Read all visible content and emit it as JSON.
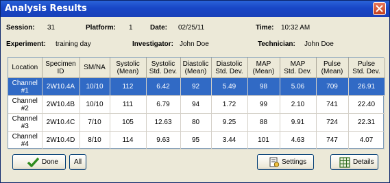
{
  "window": {
    "title": "Analysis Results"
  },
  "info": {
    "session_label": "Session:",
    "session_value": "31",
    "platform_label": "Platform:",
    "platform_value": "1",
    "date_label": "Date:",
    "date_value": "02/25/11",
    "time_label": "Time:",
    "time_value": "10:32 AM",
    "experiment_label": "Experiment:",
    "experiment_value": "training day",
    "investigator_label": "Investigator:",
    "investigator_value": "John Doe",
    "technician_label": "Technician:",
    "technician_value": "John Doe"
  },
  "table": {
    "headers": [
      [
        "Location"
      ],
      [
        "Specimen",
        "ID"
      ],
      [
        "SM/NA"
      ],
      [
        "Systolic",
        "(Mean)"
      ],
      [
        "Systolic",
        "Std. Dev."
      ],
      [
        "Diastolic",
        "(Mean)"
      ],
      [
        "Diastolic",
        "Std. Dev."
      ],
      [
        "MAP",
        "(Mean)"
      ],
      [
        "MAP",
        "Std. Dev."
      ],
      [
        "Pulse",
        "(Mean)"
      ],
      [
        "Pulse",
        "Std. Dev."
      ]
    ],
    "rows": [
      {
        "location": [
          "Channel",
          "#1"
        ],
        "cells": [
          "2W10.4A",
          "10/10",
          "112",
          "6.42",
          "92",
          "5.49",
          "98",
          "5.06",
          "709",
          "26.91"
        ]
      },
      {
        "location": [
          "Channel",
          "#2"
        ],
        "cells": [
          "2W10.4B",
          "10/10",
          "111",
          "6.79",
          "94",
          "1.72",
          "99",
          "2.10",
          "741",
          "22.40"
        ]
      },
      {
        "location": [
          "Channel",
          "#3"
        ],
        "cells": [
          "2W10.4C",
          "7/10",
          "105",
          "12.63",
          "80",
          "9.25",
          "88",
          "9.91",
          "724",
          "22.31"
        ]
      },
      {
        "location": [
          "Channel",
          "#4"
        ],
        "cells": [
          "2W10.4D",
          "8/10",
          "114",
          "9.63",
          "95",
          "3.44",
          "101",
          "4.63",
          "747",
          "4.07"
        ]
      }
    ],
    "selected_row": 0
  },
  "buttons": {
    "done": "Done",
    "all": "All",
    "settings": "Settings",
    "details": "Details"
  },
  "icons": {
    "done": "checkmark-icon",
    "settings": "settings-icon",
    "details": "details-grid-icon",
    "close": "close-icon"
  },
  "colors": {
    "titlebar": "#1846c6",
    "selection": "#316ac5",
    "window_bg": "#ece9d8",
    "close_button": "#c2401e",
    "check_green": "#2e8b1e"
  }
}
